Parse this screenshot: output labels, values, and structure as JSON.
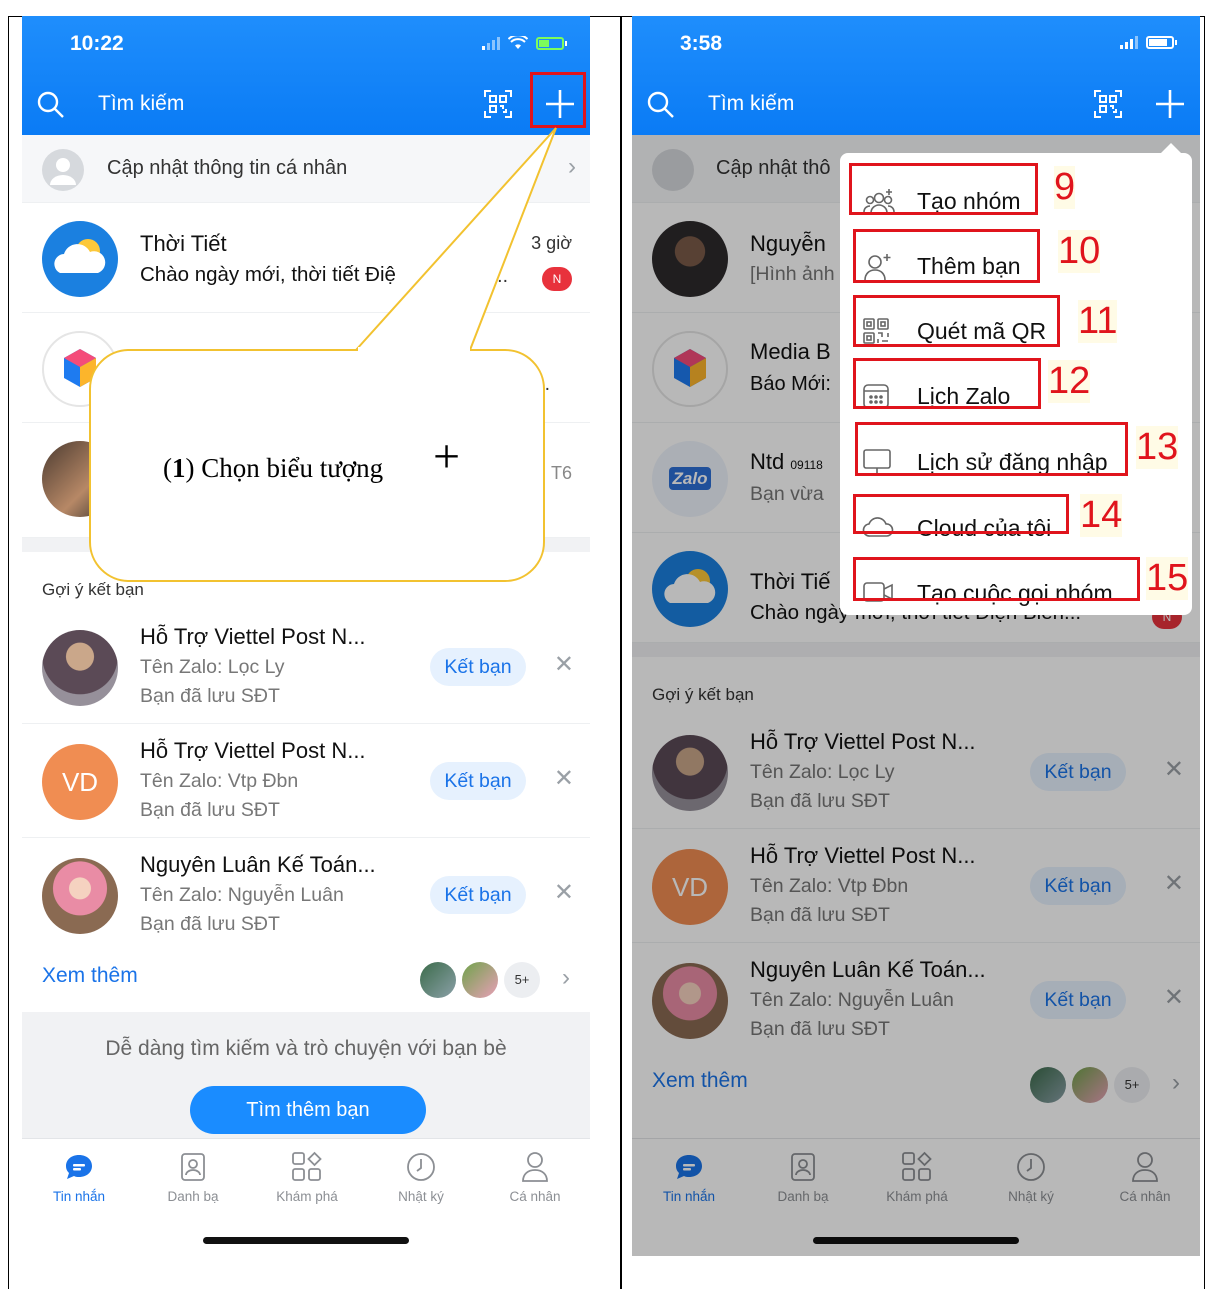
{
  "left": {
    "status": {
      "time": "10:22"
    },
    "search": {
      "placeholder": "Tìm kiếm"
    },
    "profile_update": "Cập nhật thông tin cá nhân",
    "chats": [
      {
        "name": "Thời Tiết",
        "preview": "Chào ngày mới, thời tiết Điệ",
        "time": "3 giờ",
        "badge": "N"
      },
      {
        "name": "",
        "preview": "",
        "time": "",
        "badge": ""
      },
      {
        "name": "",
        "preview": "",
        "time": "T6",
        "badge": ""
      }
    ],
    "suggest_title": "Gợi ý kết bạn",
    "suggestions": [
      {
        "name": "Hỗ Trợ Viettel Post N...",
        "zalo": "Tên Zalo: Lọc Ly",
        "note": "Bạn đã lưu SĐT",
        "button": "Kết bạn"
      },
      {
        "name": "Hỗ Trợ Viettel Post N...",
        "zalo": "Tên Zalo: Vtp Đbn",
        "note": "Bạn đã lưu SĐT",
        "button": "Kết bạn",
        "initials": "VD"
      },
      {
        "name": "Nguyên Luân Kế Toán...",
        "zalo": "Tên Zalo: Nguyễn Luân",
        "note": "Bạn đã lưu SĐT",
        "button": "Kết bạn"
      }
    ],
    "see_more": "Xem thêm",
    "more_count": "5+",
    "find_text": "Dễ dàng tìm kiếm và trò chuyện với bạn bè",
    "find_button": "Tìm thêm bạn",
    "callout": {
      "num": "1",
      "text": ") Chọn biểu tượng",
      "open": "(",
      "symbol": "+"
    }
  },
  "right": {
    "status": {
      "time": "3:58"
    },
    "search": {
      "placeholder": "Tìm kiếm"
    },
    "profile_update": "Cập nhật thô",
    "chats": [
      {
        "name": "Nguyễn",
        "preview": "[Hình ảnh"
      },
      {
        "name": "Media B",
        "preview": "Báo Mới:"
      },
      {
        "name": "Ntd",
        "phone": "09118",
        "preview": "Bạn vừa"
      },
      {
        "name": "Thời Tiế",
        "preview": "Chào ngày mới, thời tiết Điện Biên...",
        "badge": "N"
      }
    ],
    "suggest_title": "Gợi ý kết bạn",
    "suggestions": [
      {
        "name": "Hỗ Trợ Viettel Post N...",
        "zalo": "Tên Zalo: Lọc Ly",
        "note": "Bạn đã lưu SĐT",
        "button": "Kết bạn"
      },
      {
        "name": "Hỗ Trợ Viettel Post N...",
        "zalo": "Tên Zalo: Vtp Đbn",
        "note": "Bạn đã lưu SĐT",
        "button": "Kết bạn",
        "initials": "VD"
      },
      {
        "name": "Nguyên Luân Kế Toán...",
        "zalo": "Tên Zalo: Nguyễn Luân",
        "note": "Bạn đã lưu SĐT",
        "button": "Kết bạn"
      }
    ],
    "see_more": "Xem thêm",
    "more_count": "5+",
    "menu": [
      {
        "label": "Tạo nhóm",
        "num": "9",
        "icon": "group-add-icon"
      },
      {
        "label": "Thêm bạn",
        "num": "10",
        "icon": "user-add-icon"
      },
      {
        "label": "Quét mã QR",
        "num": "11",
        "icon": "qr-icon"
      },
      {
        "label": "Lịch Zalo",
        "num": "12",
        "icon": "calendar-icon"
      },
      {
        "label": "Lịch sử đăng nhập",
        "num": "13",
        "icon": "monitor-icon"
      },
      {
        "label": "Cloud của tôi",
        "num": "14",
        "icon": "cloud-icon"
      },
      {
        "label": "Tạo cuộc gọi nhóm",
        "num": "15",
        "icon": "video-call-icon"
      }
    ]
  },
  "tabs": [
    "Tin nhắn",
    "Danh bạ",
    "Khám phá",
    "Nhật ký",
    "Cá nhân"
  ],
  "zalo_logo": "Zalo",
  "colors": {
    "brand": "#0a7bf5",
    "highlight": "#e0141c",
    "callout_border": "#f2c230"
  }
}
